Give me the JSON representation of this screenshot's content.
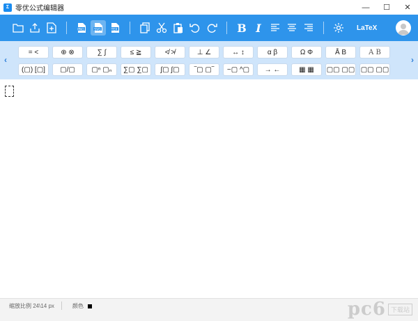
{
  "window": {
    "title": "零优公式编辑器",
    "icon_label": "Σ",
    "controls": {
      "minimize": "—",
      "maximize": "☐",
      "close": "✕"
    }
  },
  "toolbar": {
    "latex_label": "LaTeX",
    "icons": [
      "folder-open-icon",
      "export-icon",
      "new-icon",
      "save-png-icon",
      "save-svg-icon",
      "save-tex-icon",
      "copy-icon",
      "cut-icon",
      "paste-icon",
      "undo-icon",
      "redo-icon",
      "bold-icon",
      "italic-icon",
      "align-left-icon",
      "align-center-icon",
      "align-right-icon",
      "settings-icon"
    ],
    "bold_label": "B",
    "italic_label": "I",
    "accent": "#2e94eb"
  },
  "palette": {
    "row1": [
      "= <",
      "⊕ ⊗",
      "∑ ∫",
      "≤ ≧",
      "≮ ≯",
      "⊥ ∠",
      "↔ ↕",
      "α β",
      "Ω Φ",
      "Å B",
      "A B"
    ],
    "row2": [
      "(▢) [▢]",
      "▢/▢",
      "▢ⁿ ▢ₙ",
      "∑▢ ∑▢",
      "∫▢ ∫▢",
      "‾▢ ▢‾",
      "~▢ ^▢",
      "→ ←",
      "▦ ▦",
      "▢▢ ▢▢",
      "▢▢ ▢▢"
    ],
    "prev_arrow": "‹",
    "next_arrow": "›",
    "background": "#cfe5fb"
  },
  "status": {
    "zoom_label": "缩放比例 24\\14 px",
    "color_label": "颜色"
  },
  "watermark": {
    "text": "pc6",
    "box": "下载站"
  }
}
